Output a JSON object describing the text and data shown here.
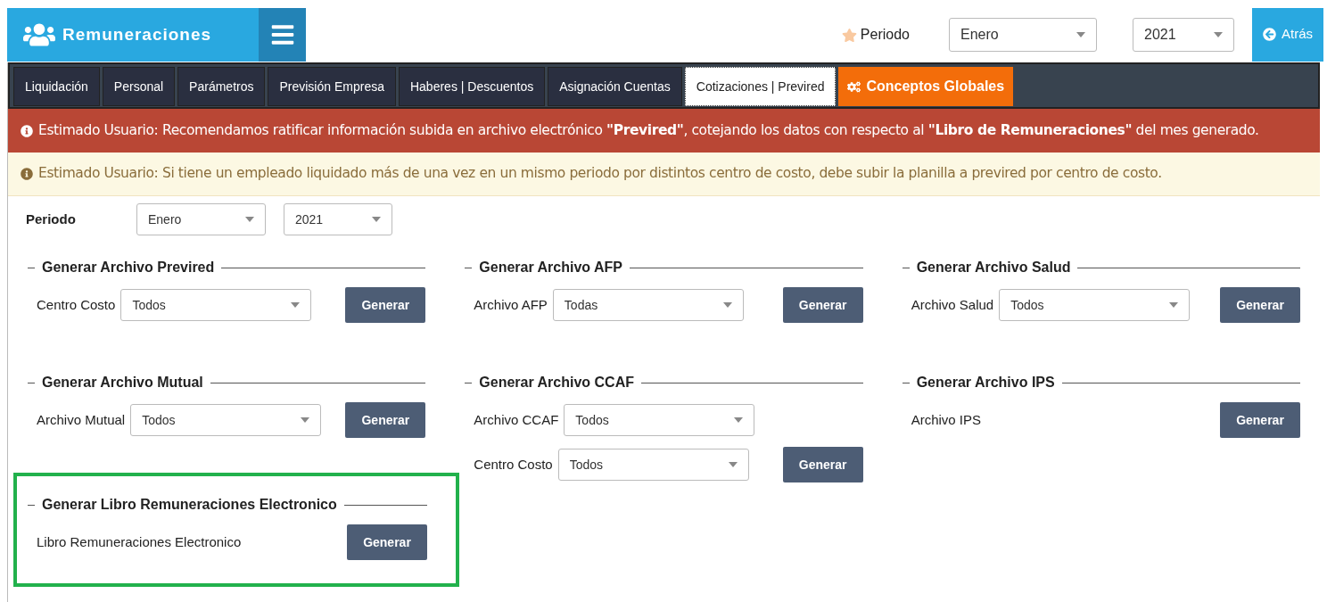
{
  "header": {
    "app_name": "Remuneraciones",
    "period_label": "Periodo",
    "period_month": "Enero",
    "period_year": "2021",
    "back_button": "Atrás"
  },
  "tabs": [
    {
      "label": "Liquidación",
      "selected": false,
      "kind": "normal"
    },
    {
      "label": "Personal",
      "selected": false,
      "kind": "normal"
    },
    {
      "label": "Parámetros",
      "selected": false,
      "kind": "normal"
    },
    {
      "label": "Previsión Empresa",
      "selected": false,
      "kind": "normal"
    },
    {
      "label": "Haberes | Descuentos",
      "selected": false,
      "kind": "normal"
    },
    {
      "label": "Asignación Cuentas",
      "selected": false,
      "kind": "normal"
    },
    {
      "label": "Cotizaciones | Previred",
      "selected": true,
      "kind": "normal"
    },
    {
      "label": "Conceptos Globales",
      "selected": false,
      "kind": "special"
    }
  ],
  "alerts": [
    {
      "kind": "danger",
      "text": "Estimado Usuario: Recomendamos ratificar información subida en archivo electrónico **\"Previred\"**, cotejando los datos con respecto al **\"Libro de Remuneraciones\"** del mes generado."
    },
    {
      "kind": "warning",
      "text": "Estimado Usuario: Si tiene un empleado liquidado más de una vez en un mismo periodo por distintos centro de costo, debe subir la planilla a previred por centro de costo."
    }
  ],
  "period": {
    "label": "Periodo",
    "month": "Enero",
    "year": "2021"
  },
  "sections": [
    {
      "title": "Generar Archivo Previred",
      "highlighted": false,
      "fields": [
        {
          "label": "Centro Costo",
          "value": "Todos"
        }
      ],
      "button": "Generar"
    },
    {
      "title": "Generar Archivo AFP",
      "highlighted": false,
      "fields": [
        {
          "label": "Archivo AFP",
          "value": "Todas"
        }
      ],
      "button": "Generar"
    },
    {
      "title": "Generar Archivo Salud",
      "highlighted": false,
      "fields": [
        {
          "label": "Archivo Salud",
          "value": "Todos"
        }
      ],
      "button": "Generar"
    },
    {
      "title": "Generar Archivo Mutual",
      "highlighted": false,
      "fields": [
        {
          "label": "Archivo Mutual",
          "value": "Todos"
        }
      ],
      "button": "Generar"
    },
    {
      "title": "Generar Archivo CCAF",
      "highlighted": false,
      "fields": [
        {
          "label": "Archivo CCAF",
          "value": "Todos"
        },
        {
          "label": "Centro Costo",
          "value": "Todos"
        }
      ],
      "button": "Generar"
    },
    {
      "title": "Generar Archivo IPS",
      "highlighted": false,
      "fields": [
        {
          "label": "Archivo IPS"
        }
      ],
      "button": "Generar"
    },
    {
      "title": "Generar Libro Remuneraciones Electronico",
      "highlighted": true,
      "fields": [
        {
          "label": "Libro Remuneraciones Electronico"
        }
      ],
      "button": "Generar"
    }
  ]
}
